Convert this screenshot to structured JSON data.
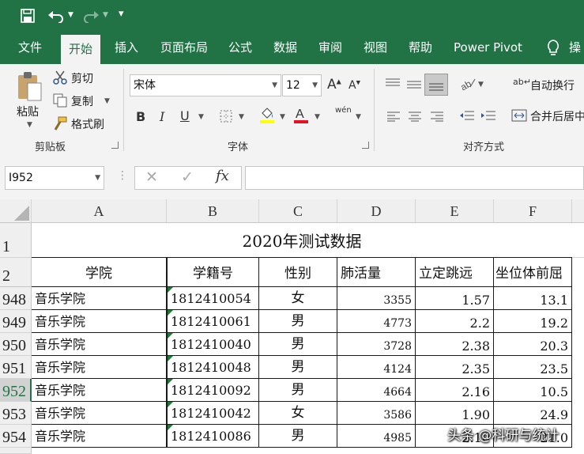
{
  "qat": {
    "save_icon": "save-icon",
    "undo_icon": "undo-icon",
    "redo_icon": "redo-icon",
    "customize": "▾"
  },
  "tabs": [
    {
      "label": "文件"
    },
    {
      "label": "开始"
    },
    {
      "label": "插入"
    },
    {
      "label": "页面布局"
    },
    {
      "label": "公式"
    },
    {
      "label": "数据"
    },
    {
      "label": "审阅"
    },
    {
      "label": "视图"
    },
    {
      "label": "帮助"
    },
    {
      "label": "Power Pivot"
    }
  ],
  "tell_me_partial": "操",
  "ribbon": {
    "clipboard": {
      "paste": "粘贴",
      "cut": "剪切",
      "copy": "复制",
      "format_painter": "格式刷",
      "group": "剪贴板"
    },
    "font": {
      "name": "宋体",
      "size": "12",
      "bold": "B",
      "italic": "I",
      "underline": "U",
      "phonetic": "wén",
      "group": "字体"
    },
    "alignment": {
      "wrap": "自动换行",
      "merge": "合并后居中",
      "group": "对齐方式"
    }
  },
  "formula_bar": {
    "name_box": "I952",
    "cancel": "✕",
    "enter": "✓",
    "fx": "fx",
    "content": ""
  },
  "sheet": {
    "columns": [
      "A",
      "B",
      "C",
      "D",
      "E",
      "F"
    ],
    "title_row": "1",
    "title": "2020年测试数据",
    "header_row": "2",
    "headers": [
      "学院",
      "学籍号",
      "性别",
      "肺活量",
      "立定跳远",
      "坐位体前屈"
    ],
    "rows": [
      {
        "num": "948",
        "college": "音乐学院",
        "id": "1812410054",
        "gender": "女",
        "lung": "3355",
        "jump": "1.57",
        "reach": "13.1"
      },
      {
        "num": "949",
        "college": "音乐学院",
        "id": "1812410061",
        "gender": "男",
        "lung": "4773",
        "jump": "2.2",
        "reach": "19.2"
      },
      {
        "num": "950",
        "college": "音乐学院",
        "id": "1812410040",
        "gender": "男",
        "lung": "3728",
        "jump": "2.38",
        "reach": "20.3"
      },
      {
        "num": "951",
        "college": "音乐学院",
        "id": "1812410048",
        "gender": "男",
        "lung": "4124",
        "jump": "2.35",
        "reach": "23.5"
      },
      {
        "num": "952",
        "college": "音乐学院",
        "id": "1812410092",
        "gender": "男",
        "lung": "4664",
        "jump": "2.16",
        "reach": "10.5"
      },
      {
        "num": "953",
        "college": "音乐学院",
        "id": "1812410042",
        "gender": "女",
        "lung": "3586",
        "jump": "1.90",
        "reach": "24.9"
      },
      {
        "num": "954",
        "college": "音乐学院",
        "id": "1812410086",
        "gender": "男",
        "lung": "4985",
        "jump": "2.10",
        "reach": "21.0"
      }
    ]
  },
  "watermark": "头条 @科研与统计",
  "colors": {
    "excel_green": "#217346",
    "font_color_red": "#e81123",
    "fill_yellow": "#ffff00",
    "selected_row_header": "#217346"
  }
}
